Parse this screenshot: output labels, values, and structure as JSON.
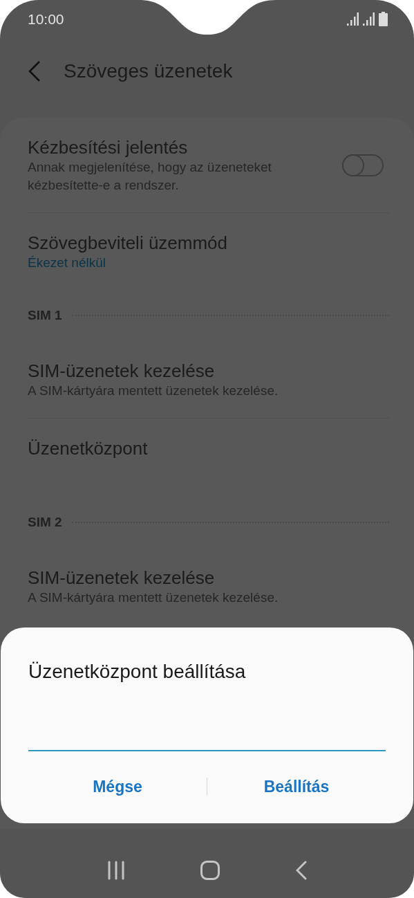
{
  "status_bar": {
    "time": "10:00"
  },
  "header": {
    "title": "Szöveges üzenetek"
  },
  "settings": [
    {
      "kind": "switch",
      "title": "Kézbesítési jelentés",
      "subtitle": "Annak megjelenítése, hogy az üzeneteket kézbesítette-e a rendszer.",
      "on": false
    },
    {
      "kind": "value",
      "title": "Szövegbeviteli üzemmód",
      "value": "Ékezet nélkül"
    },
    {
      "kind": "section",
      "title": "SIM 1"
    },
    {
      "kind": "item",
      "title": "SIM-üzenetek kezelése",
      "subtitle": "A SIM-kártyára mentett üzenetek kezelése."
    },
    {
      "kind": "item",
      "title": "Üzenetközpont"
    },
    {
      "kind": "section",
      "title": "SIM 2"
    },
    {
      "kind": "item",
      "title": "SIM-üzenetek kezelése",
      "subtitle": "A SIM-kártyára mentett üzenetek kezelése."
    }
  ],
  "dialog": {
    "title": "Üzenetközpont beállítása",
    "buttons": [
      "Mégse",
      "Beállítás"
    ]
  }
}
